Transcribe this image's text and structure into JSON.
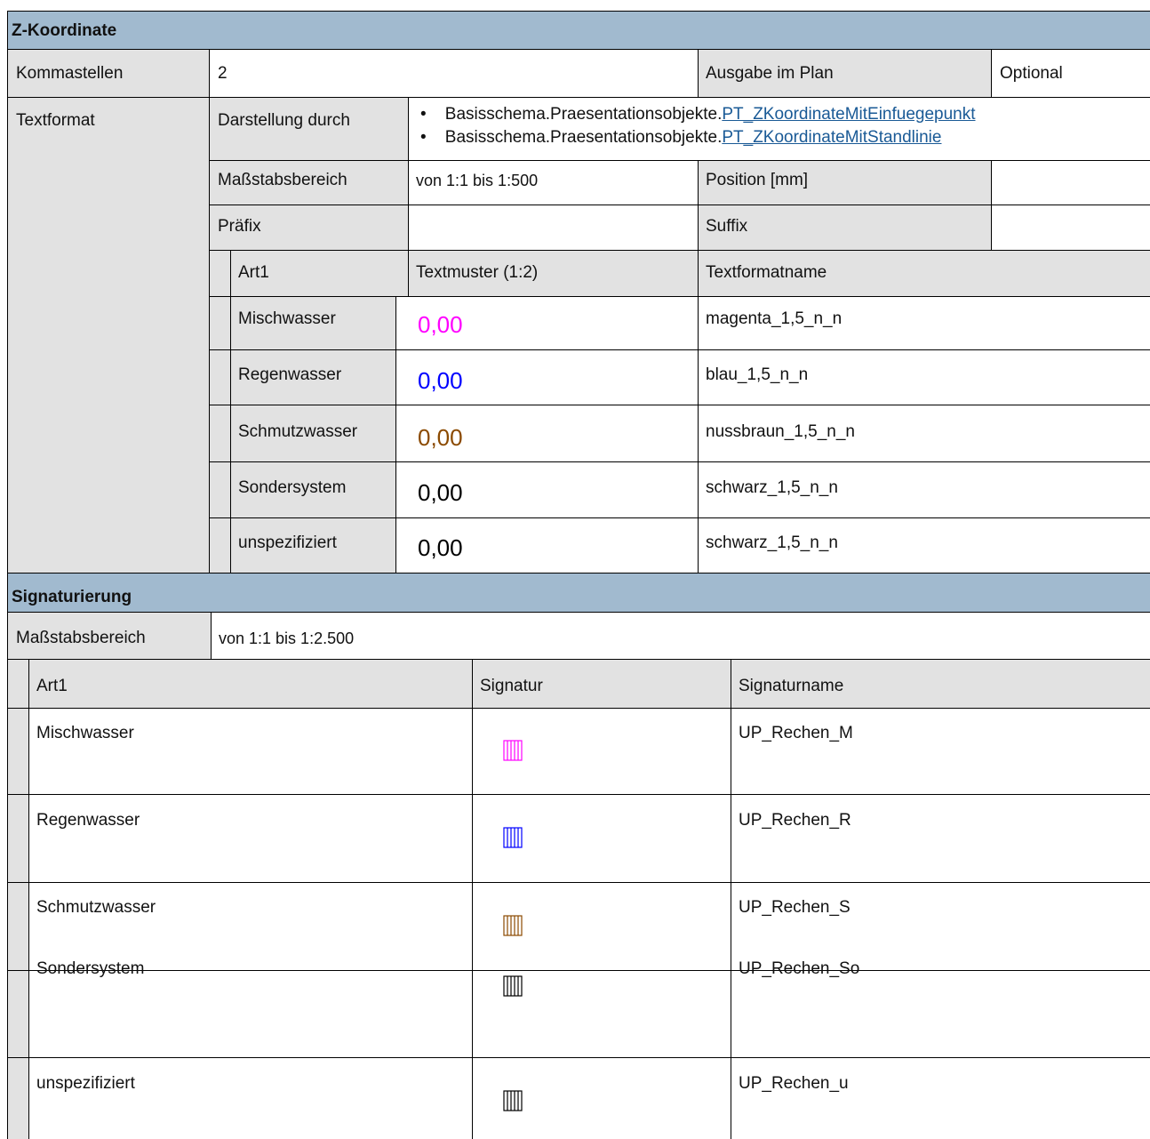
{
  "z_section": {
    "title": "Z-Koordinate",
    "kommastellen_label": "Kommastellen",
    "kommastellen_value": "2",
    "ausgabe_label": "Ausgabe im Plan",
    "ausgabe_value": "Optional",
    "textformat_label": "Textformat",
    "darstellung_label": "Darstellung durch",
    "darstellung_items": [
      {
        "prefix": "Basisschema.Praesentationsobjekte.",
        "link": "PT_ZKoordinateMitEinfuegepunkt"
      },
      {
        "prefix": "Basisschema.Praesentationsobjekte.",
        "link": "PT_ZKoordinateMitStandlinie"
      }
    ],
    "massstab_label": "Maßstabsbereich",
    "massstab_value": "von 1:1 bis 1:500",
    "position_label": "Position [mm]",
    "position_value": "",
    "praefix_label": "Präfix",
    "praefix_value": "",
    "suffix_label": "Suffix",
    "suffix_value": "",
    "table_headers": {
      "art": "Art1",
      "muster": "Textmuster (1:2)",
      "name": "Textformatname"
    },
    "rows": [
      {
        "art": "Mischwasser",
        "muster": "0,00",
        "name": "magenta_1,5_n_n",
        "color": "#ff00ff"
      },
      {
        "art": "Regenwasser",
        "muster": "0,00",
        "name": "blau_1,5_n_n",
        "color": "#0000ff"
      },
      {
        "art": "Schmutzwasser",
        "muster": "0,00",
        "name": "nussbraun_1,5_n_n",
        "color": "#8b4a00"
      },
      {
        "art": "Sondersystem",
        "muster": "0,00",
        "name": "schwarz_1,5_n_n",
        "color": "#000000"
      },
      {
        "art": "unspezifiziert",
        "muster": "0,00",
        "name": "schwarz_1,5_n_n",
        "color": "#000000"
      }
    ]
  },
  "sig_section": {
    "title": "Signaturierung",
    "massstab_label": "Maßstabsbereich",
    "massstab_value": "von 1:1 bis 1:2.500",
    "table_headers": {
      "art": "Art1",
      "signatur": "Signatur",
      "name": "Signaturname"
    },
    "rows": [
      {
        "art": "Mischwasser",
        "name": "UP_Rechen_M",
        "color": "#ff00ff",
        "icon": "rechen-icon"
      },
      {
        "art": "Regenwasser",
        "name": "UP_Rechen_R",
        "color": "#0000ff",
        "icon": "rechen-icon"
      },
      {
        "art": "Schmutzwasser",
        "name": "UP_Rechen_S",
        "color": "#8b4a00",
        "icon": "rechen-icon"
      },
      {
        "art": "Sondersystem",
        "name": "UP_Rechen_So",
        "color": "#000000",
        "icon": "rechen-icon"
      },
      {
        "art": "unspezifiziert",
        "name": "UP_Rechen_u",
        "color": "#000000",
        "icon": "rechen-icon"
      }
    ]
  }
}
